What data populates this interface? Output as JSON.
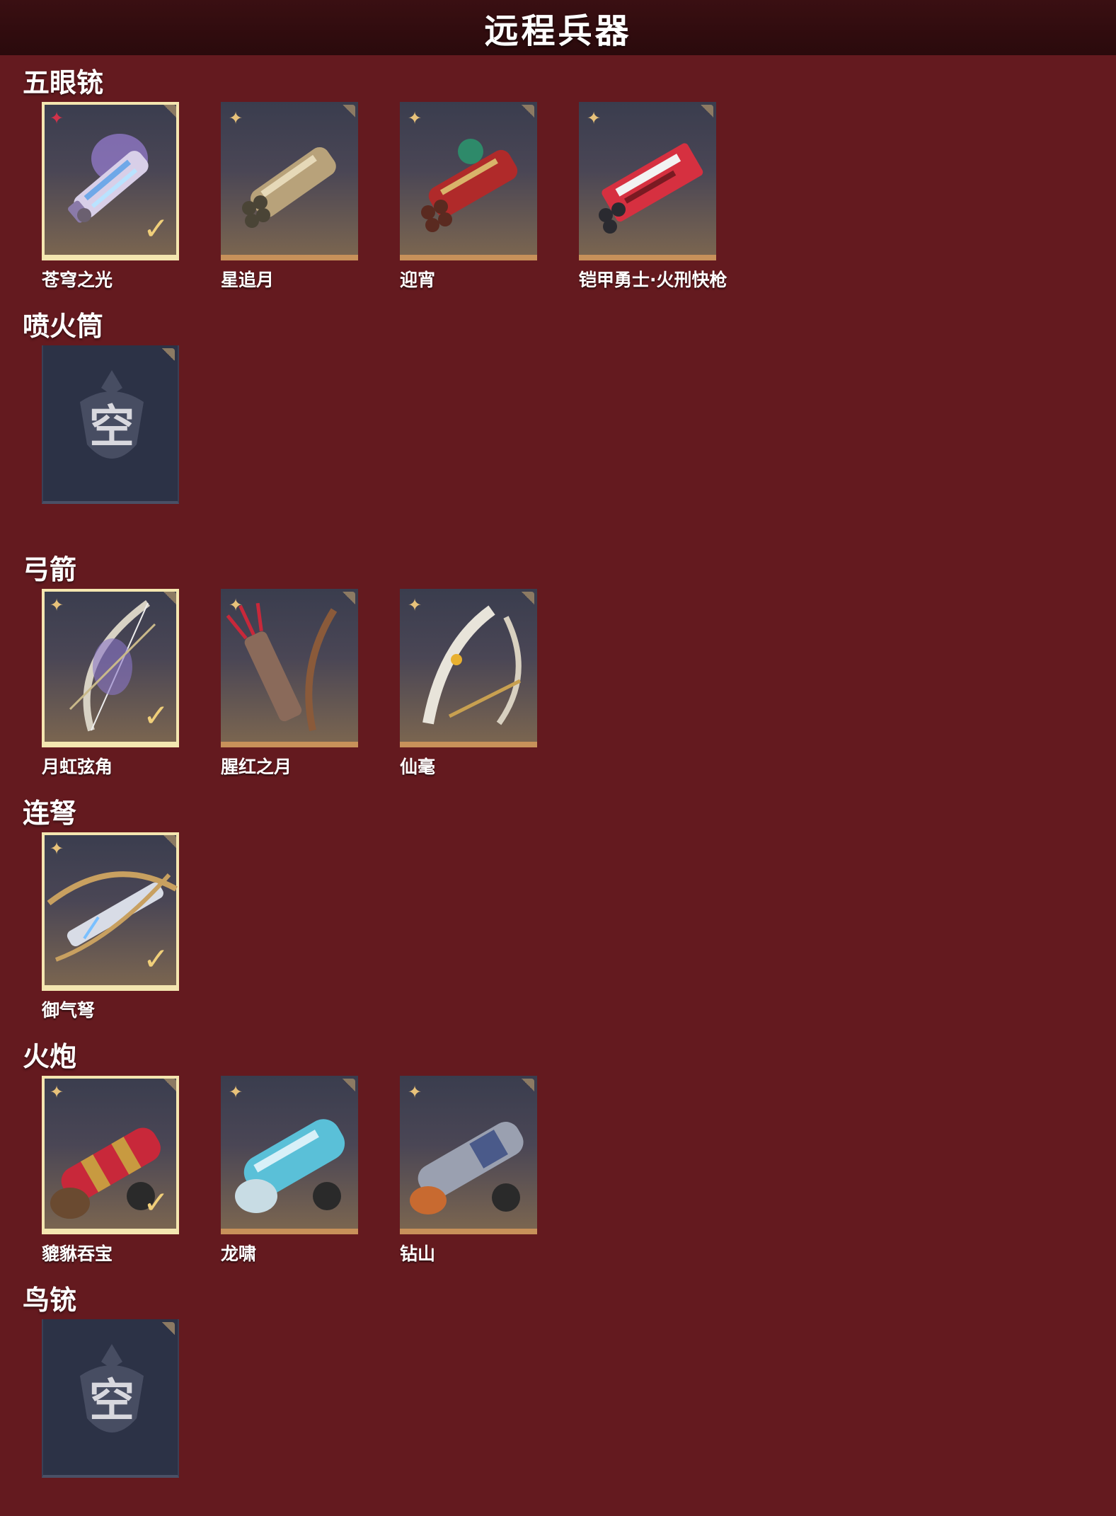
{
  "header": {
    "title": "远程兵器"
  },
  "sections": [
    {
      "title": "五眼铳",
      "items": [
        {
          "name": "苍穹之光",
          "selected": true,
          "rarity": "red",
          "icon": "blunderbuss-purple-icon"
        },
        {
          "name": "星追月",
          "selected": false,
          "rarity": "gold",
          "icon": "blunderbuss-gold-icon"
        },
        {
          "name": "迎宵",
          "selected": false,
          "rarity": "gold",
          "icon": "blunderbuss-red-dragon-icon"
        },
        {
          "name": "铠甲勇士·火刑快枪",
          "selected": false,
          "rarity": "gold",
          "icon": "blunderbuss-mech-red-icon"
        }
      ]
    },
    {
      "title": "喷火筒",
      "items": [
        {
          "name": "",
          "empty": true,
          "empty_text": "空"
        }
      ]
    },
    {
      "title": "弓箭",
      "items": [
        {
          "name": "月虹弦角",
          "selected": true,
          "rarity": "gold",
          "icon": "bow-silver-icon"
        },
        {
          "name": "腥红之月",
          "selected": false,
          "rarity": "gold",
          "icon": "bow-quiver-red-icon"
        },
        {
          "name": "仙毫",
          "selected": false,
          "rarity": "gold",
          "icon": "bow-white-icon"
        }
      ]
    },
    {
      "title": "连弩",
      "items": [
        {
          "name": "御气弩",
          "selected": true,
          "rarity": "gold",
          "icon": "crossbow-icon"
        }
      ]
    },
    {
      "title": "火炮",
      "items": [
        {
          "name": "貔貅吞宝",
          "selected": true,
          "rarity": "gold",
          "icon": "cannon-red-icon"
        },
        {
          "name": "龙啸",
          "selected": false,
          "rarity": "gold",
          "icon": "cannon-dragon-icon"
        },
        {
          "name": "钻山",
          "selected": false,
          "rarity": "gold",
          "icon": "cannon-silver-icon"
        }
      ]
    },
    {
      "title": "鸟铳",
      "items": [
        {
          "name": "",
          "empty": true,
          "empty_text": "空"
        }
      ]
    }
  ],
  "colors": {
    "background": "#641a1f",
    "header": "#2a0a0c",
    "selected_border": "#f4e6b0",
    "card_bottom": "#c8915a",
    "empty_card": "#2c3246"
  }
}
